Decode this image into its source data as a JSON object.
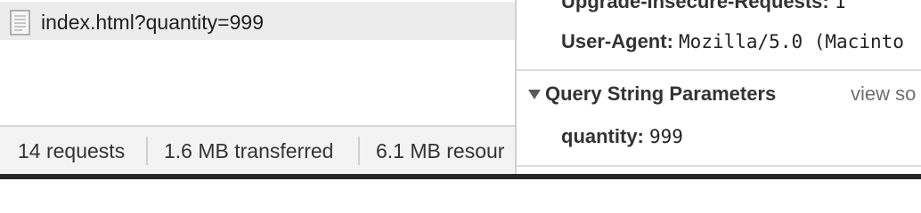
{
  "request_list": {
    "selected_request": {
      "icon": "document-icon",
      "name": "index.html?quantity=999"
    },
    "status_bar": {
      "requests": "14 requests",
      "transferred": "1.6 MB transferred",
      "resources": "6.1 MB resour"
    }
  },
  "details": {
    "request_headers": [
      {
        "key": "Upgrade-Insecure-Requests:",
        "value": "1"
      },
      {
        "key": "User-Agent:",
        "value": "Mozilla/5.0 (Macinto"
      }
    ],
    "query_section": {
      "title": "Query String Parameters",
      "toggle_icon": "triangle-down-icon",
      "view_source_label": "view so",
      "params": [
        {
          "key": "quantity:",
          "value": "999"
        }
      ]
    }
  }
}
